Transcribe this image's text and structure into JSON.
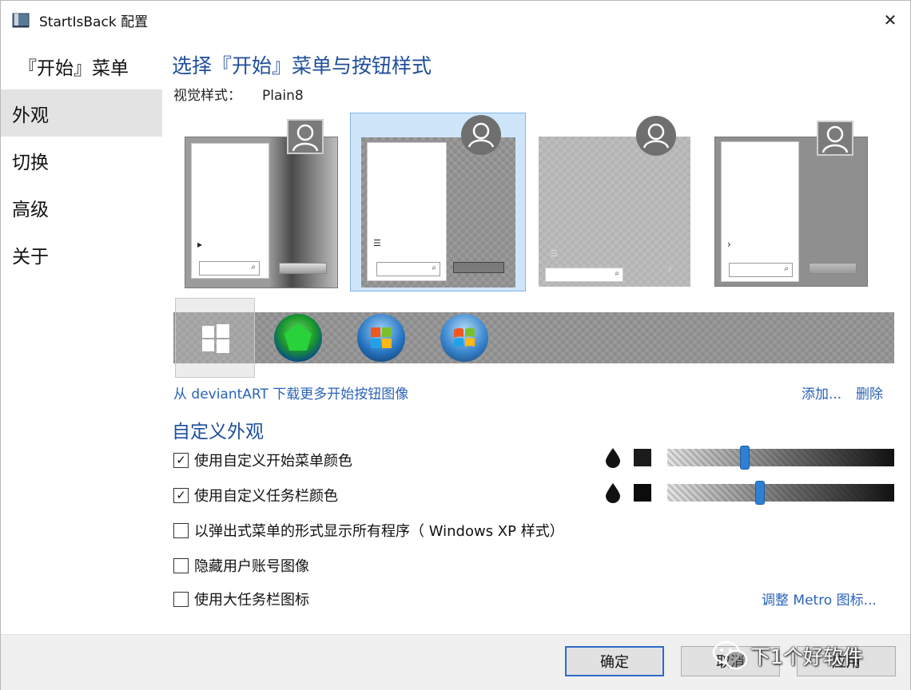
{
  "window": {
    "title": "StartIsBack 配置",
    "close_glyph": "✕"
  },
  "sidebar": {
    "items": [
      {
        "label": "『开始』菜单",
        "active": false
      },
      {
        "label": "外观",
        "active": true
      },
      {
        "label": "切换",
        "active": false
      },
      {
        "label": "高级",
        "active": false
      },
      {
        "label": "关于",
        "active": false
      }
    ]
  },
  "main": {
    "heading": "选择『开始』菜单与按钮样式",
    "visual_style_label": "视觉样式：",
    "visual_style_value": "Plain8",
    "previews": [
      {
        "name": "style-preview-1",
        "selected": false
      },
      {
        "name": "style-preview-2",
        "selected": true
      },
      {
        "name": "style-preview-3",
        "selected": false
      },
      {
        "name": "style-preview-4",
        "selected": false
      }
    ],
    "orbs": [
      {
        "name": "windows-8-flag",
        "selected": true
      },
      {
        "name": "green-orb",
        "selected": false
      },
      {
        "name": "windows-7-orb",
        "selected": false
      },
      {
        "name": "windows-7-orb-alt",
        "selected": false
      }
    ],
    "deviantart_link": "从 deviantART 下载更多开始按钮图像",
    "add_link": "添加...",
    "remove_link": "删除"
  },
  "custom": {
    "heading": "自定义外观",
    "options": [
      {
        "label": "使用自定义开始菜单颜色",
        "checked": true
      },
      {
        "label": "使用自定义任务栏颜色",
        "checked": true
      },
      {
        "label": "以弹出式菜单的形式显示所有程序（ Windows XP 样式）",
        "checked": false
      },
      {
        "label": "隐藏用户账号图像",
        "checked": false
      },
      {
        "label": "使用大任务栏图标",
        "checked": false
      }
    ],
    "check_glyph": "✓",
    "start_menu_slider_value": 0.34,
    "taskbar_slider_value": 0.41,
    "swatch_color": "#1b1b1b",
    "accent_color": "#2f7fd3",
    "metro_link": "调整 Metro 图标..."
  },
  "footer": {
    "ok": "确定",
    "cancel": "取消",
    "apply": "应用",
    "watermark": "下1个好软件"
  }
}
